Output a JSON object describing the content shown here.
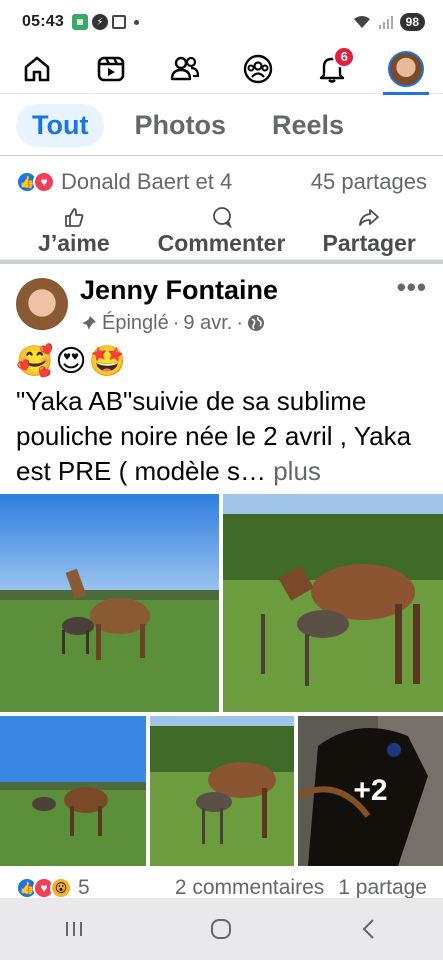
{
  "status_bar": {
    "time": "05:43",
    "battery": "98"
  },
  "nav": {
    "items": [
      "home",
      "reels",
      "friends",
      "groups",
      "notifications",
      "profile"
    ],
    "notification_badge": "6"
  },
  "filter_tabs": [
    {
      "label": "Tout",
      "active": true
    },
    {
      "label": "Photos",
      "active": false
    },
    {
      "label": "Reels",
      "active": false
    }
  ],
  "previous_post": {
    "reactions_text": "Donald Baert et 4",
    "shares_text": "45 partages",
    "actions": {
      "like": "J’aime",
      "comment": "Commenter",
      "share": "Partager"
    }
  },
  "post": {
    "author": "Jenny Fontaine",
    "pinned_label": "Épinglé",
    "date": "9 avr.",
    "separator": "·",
    "emojis": "🥰😍🤩",
    "text": "\"Yaka AB\"suivie de sa sublime pouliche noire née le 2 avril , Yaka est PRE ( modèle s…",
    "more_label": "plus",
    "extra_photos": "+2",
    "reaction_count": "5",
    "comments_text": "2 commentaires",
    "shares_text": "1 partage"
  },
  "colors": {
    "accent": "#1b74e4",
    "badge": "#e41e3f"
  }
}
